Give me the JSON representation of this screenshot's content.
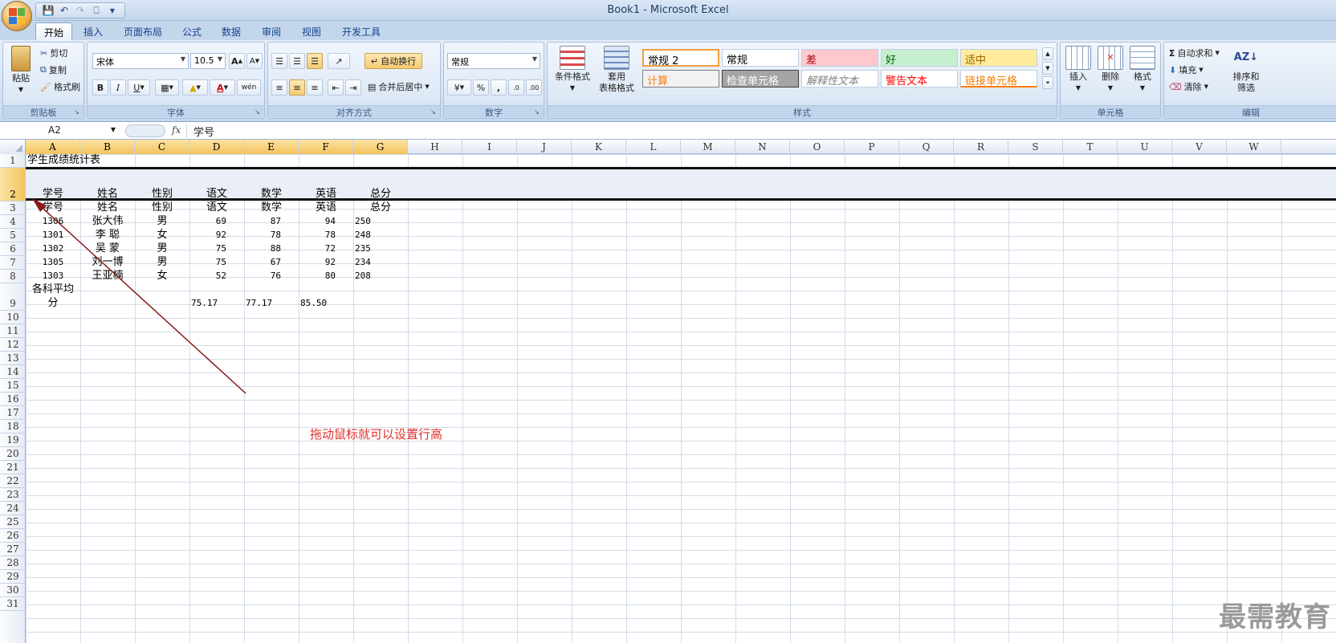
{
  "window": {
    "title": "Book1 - Microsoft Excel"
  },
  "tabs": [
    "开始",
    "插入",
    "页面布局",
    "公式",
    "数据",
    "审阅",
    "视图",
    "开发工具"
  ],
  "ribbon": {
    "clipboard": {
      "label": "剪贴板",
      "paste": "粘贴",
      "cut": "剪切",
      "copy": "复制",
      "format_painter": "格式刷"
    },
    "font": {
      "label": "字体",
      "family": "宋体",
      "size": "10.5",
      "bold": "B",
      "italic": "I",
      "underline": "U"
    },
    "alignment": {
      "label": "对齐方式",
      "wrap": "自动换行",
      "merge": "合并后居中"
    },
    "number": {
      "label": "数字",
      "format": "常规",
      "percent": "%",
      "comma": ","
    },
    "styles": {
      "label": "样式",
      "conditional": "条件格式",
      "table_format_1": "套用",
      "table_format_2": "表格格式",
      "cells": [
        {
          "text": "常规 2",
          "bg": "#ffffff",
          "fg": "#000000",
          "border": "#f0a040"
        },
        {
          "text": "常规",
          "bg": "#ffffff",
          "fg": "#000000",
          "border": "#c0cfe2"
        },
        {
          "text": "差",
          "bg": "#ffc7ce",
          "fg": "#9c0006",
          "border": "#c0cfe2"
        },
        {
          "text": "好",
          "bg": "#c6efce",
          "fg": "#006100",
          "border": "#c0cfe2"
        },
        {
          "text": "适中",
          "bg": "#ffeb9c",
          "fg": "#9c6500",
          "border": "#c0cfe2"
        },
        {
          "text": "计算",
          "bg": "#f2f2f2",
          "fg": "#fa7d00",
          "border": "#7f7f7f"
        },
        {
          "text": "检查单元格",
          "bg": "#a5a5a5",
          "fg": "#ffffff",
          "border": "#3f3f3f"
        },
        {
          "text": "解释性文本",
          "bg": "#ffffff",
          "fg": "#7f7f7f",
          "border": "#c0cfe2"
        },
        {
          "text": "警告文本",
          "bg": "#ffffff",
          "fg": "#ff0000",
          "border": "#c0cfe2"
        },
        {
          "text": "链接单元格",
          "bg": "#ffffff",
          "fg": "#fa7d00",
          "border": "#c0cfe2"
        }
      ]
    },
    "cells_group": {
      "label": "单元格",
      "insert": "插入",
      "delete": "删除",
      "format": "格式"
    },
    "editing": {
      "label": "编辑",
      "autosum": "自动求和",
      "fill": "填充",
      "clear": "清除",
      "sort_1": "排序和",
      "sort_2": "筛选"
    }
  },
  "formula_bar": {
    "name_box": "A2",
    "fx": "fx",
    "formula": "学号"
  },
  "columns": [
    "A",
    "B",
    "C",
    "D",
    "E",
    "F",
    "G",
    "H",
    "I",
    "J",
    "K",
    "L",
    "M",
    "N",
    "O",
    "P",
    "Q",
    "R",
    "S",
    "T",
    "U",
    "V",
    "W"
  ],
  "rows": [
    "1",
    "2",
    "3",
    "4",
    "5",
    "6",
    "7",
    "8",
    "9",
    "10",
    "11",
    "12",
    "13",
    "14",
    "15",
    "16",
    "17",
    "18",
    "19",
    "20",
    "21",
    "22",
    "23",
    "24",
    "25",
    "26",
    "27",
    "28",
    "29",
    "30",
    "31"
  ],
  "sheet": {
    "title": "学生成绩统计表",
    "header": [
      "学号",
      "姓名",
      "性别",
      "语文",
      "数学",
      "英语",
      "总分"
    ],
    "students": [
      [
        "1306",
        "张大伟",
        "男",
        "69",
        "87",
        "94",
        "250"
      ],
      [
        "1301",
        "李  聪",
        "女",
        "92",
        "78",
        "78",
        "248"
      ],
      [
        "1302",
        "吴  蒙",
        "男",
        "75",
        "88",
        "72",
        "235"
      ],
      [
        "1305",
        "刘一博",
        "男",
        "75",
        "67",
        "92",
        "234"
      ],
      [
        "1303",
        "王亚楠",
        "女",
        "52",
        "76",
        "80",
        "208"
      ]
    ],
    "avg_label_1": "各科平均",
    "avg_label_2": "分",
    "averages": [
      "75.17",
      "77.17",
      "85.50"
    ]
  },
  "annotation": "拖动鼠标就可以设置行高",
  "watermark": "最需教育",
  "colors": {
    "accent": "#f4c35e",
    "annotation": "#e0302b",
    "arrow": "#8b1a1a"
  }
}
